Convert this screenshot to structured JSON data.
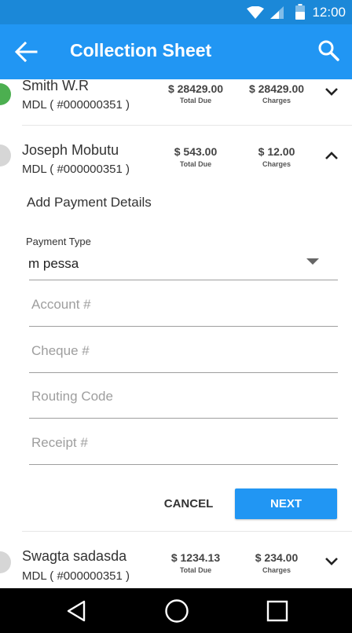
{
  "status_bar": {
    "time": "12:00"
  },
  "app_bar": {
    "title": "Collection Sheet"
  },
  "colors": {
    "primary": "#2196f3",
    "primary_dark": "#1b88d8",
    "green_status": "#4caf50",
    "grey_status": "#d6d6d6"
  },
  "clients": [
    {
      "name": "Smith W.R",
      "account": "MDL ( #000000351 )",
      "total_due": "$ 28429.00",
      "total_due_label": "Total Due",
      "charges": "$ 28429.00",
      "charges_label": "Charges",
      "status": "green",
      "expanded": false
    },
    {
      "name": "Joseph Mobutu",
      "account": "MDL ( #000000351 )",
      "total_due": "$ 543.00",
      "total_due_label": "Total Due",
      "charges": "$ 12.00",
      "charges_label": "Charges",
      "status": "grey",
      "expanded": true
    },
    {
      "name": "Swagta sadasda",
      "account": "MDL ( #000000351 )",
      "total_due": "$ 1234.13",
      "total_due_label": "Total Due",
      "charges": "$ 234.00",
      "charges_label": "Charges",
      "status": "grey",
      "expanded": false
    }
  ],
  "payment_form": {
    "section_title": "Add Payment Details",
    "payment_type_label": "Payment Type",
    "payment_type_value": "m pessa",
    "account_placeholder": "Account #",
    "cheque_placeholder": "Cheque #",
    "routing_placeholder": "Routing Code",
    "receipt_placeholder": "Receipt #",
    "cancel_label": "CANCEL",
    "next_label": "NEXT"
  }
}
